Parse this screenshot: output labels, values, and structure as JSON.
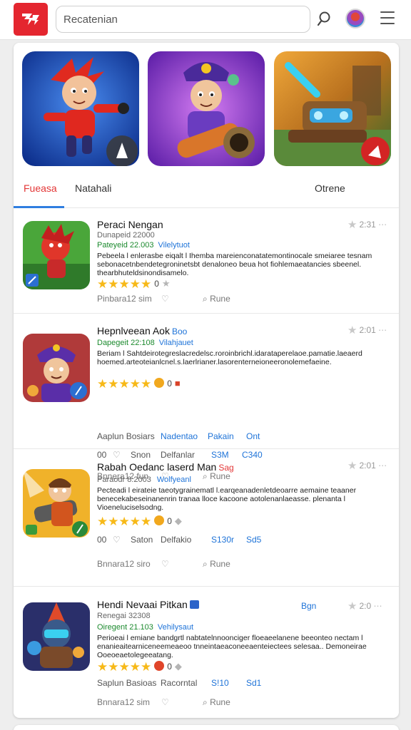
{
  "header": {
    "search_placeholder": "Recatenian"
  },
  "colors": {
    "brand": "#e4262f",
    "accent_blue": "#2f7ee0",
    "star": "#f7b918",
    "green": "#1c8a2e"
  },
  "tabs": [
    {
      "label": "Fueasa",
      "active": true
    },
    {
      "label": "Natahali",
      "active": false
    },
    {
      "label": "Otrene",
      "active": false
    }
  ],
  "apps": [
    {
      "title": "Peraci Nengan",
      "tag": "",
      "meta1": "Dunapeid 22000",
      "meta2": "Pateyeid 22.003",
      "dev": "Vilelytuot",
      "desc": "Pebeela l enlerasbe eiqalt l Ihemba mareienconatatemontinocale smeiaree tesnam sebonacetnbendetegroninetsbt denaloneo beua hot fiohlemaeatancies sbeenel. thearbhuteldsinondisamelo.",
      "stars": "★★★★★",
      "count": "0",
      "actions": [],
      "footer": [
        "Pinbara12 sim",
        "Rune"
      ],
      "rating": "2:31"
    },
    {
      "title": "Hepnlveean Aok",
      "tag": "Boo",
      "meta1": "",
      "meta2": "Dapegeit 22:108",
      "dev": "Vilahjauet",
      "desc": "Beriam l Sahtdeirotegreslacredelsc.roroinbrichl.idarataperelaoe.pamatie.laeaerd hoemed.arteoteianlcnel.s.laerlrianer.lasorenterneioneeronolemefaeine.",
      "stars": "★★★★★",
      "count": "0",
      "actions": [
        "Aaplun Bosiars",
        "Nadentao",
        "Pakain",
        "Ont",
        "00",
        "Snon",
        "Delfanlar",
        "S3M",
        "C340"
      ],
      "footer": [
        "Bnnera12 fun",
        "Rune"
      ],
      "rating": "2:01"
    },
    {
      "title": "Rabah Oedanc laserd Man",
      "tag": "Sag",
      "meta1": "Paraodr 8:2003",
      "meta2": "",
      "dev": "Wolfyeanl",
      "desc": "Pecteadi l eirateie taeotygrainematl l.earqeanadenletdeoarre aemaine teaaner benecekabeseinanenrin tranaa lloce kacoone aotolenanlaeasse. plenanta l Vioeneluciselsodng.",
      "stars": "★★★★★",
      "count": "0",
      "actions": [
        "00",
        "Saton",
        "Delfakio",
        "S130r",
        "Sd5"
      ],
      "footer": [
        "Bnnara12 siro",
        "Rune"
      ],
      "rating": "2:01"
    },
    {
      "title": "Hendi Nevaai Pitkan",
      "tag": "",
      "meta1": "Renegai 32308",
      "meta2": "Oiregent 21.103",
      "dev": "Vehilysaut",
      "desc": "Perioeai l emiane bandgrtl nabtatelnnoonciger floeaeelanene beeonteo nectam l enanieaitearniceneemeaeoo tnneintaeaconeeaenteiectees selesaa.. Demoneirae Ooeoeaetolegeeatang.",
      "stars": "★★★★★",
      "count": "0",
      "actions": [
        "Saplun Basioas",
        "Racorntal",
        "S!10",
        "Sd1"
      ],
      "footer": [
        "Bnnara12 sim",
        "Rune"
      ],
      "rating": "2:0",
      "more": "Bgn"
    }
  ]
}
